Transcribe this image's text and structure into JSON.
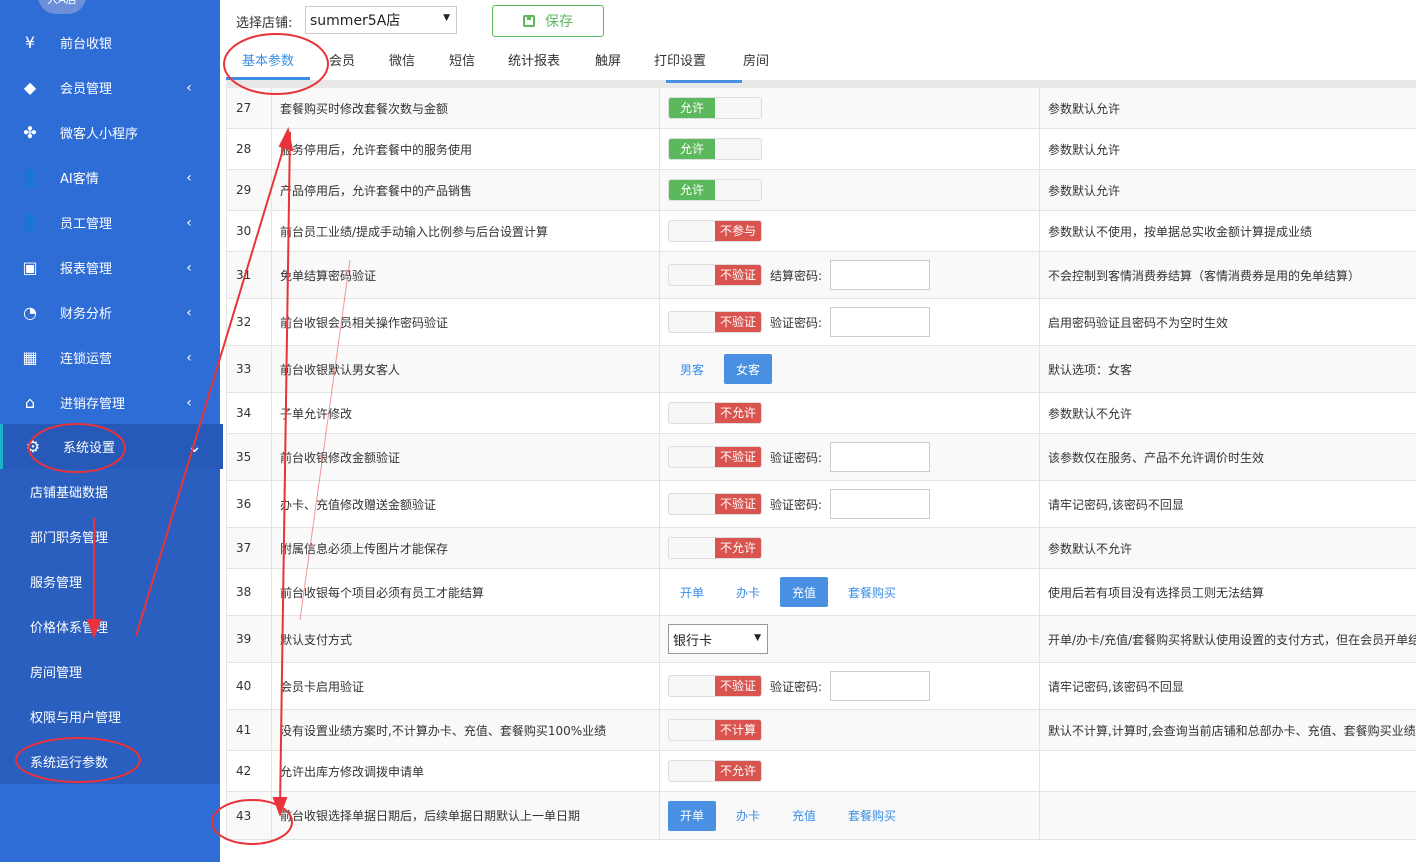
{
  "sidebar": {
    "logo_text": "人A店",
    "items": [
      {
        "label": "前台收银",
        "icon": "yen-icon",
        "chevron": false
      },
      {
        "label": "会员管理",
        "icon": "diamond-icon",
        "chevron": true
      },
      {
        "label": "微客人小程序",
        "icon": "clover-icon",
        "chevron": false
      },
      {
        "label": "AI客情",
        "icon": "user-search-icon",
        "chevron": true
      },
      {
        "label": "员工管理",
        "icon": "user-icon",
        "chevron": true
      },
      {
        "label": "报表管理",
        "icon": "monitor-icon",
        "chevron": true
      },
      {
        "label": "财务分析",
        "icon": "pie-chart-icon",
        "chevron": true
      },
      {
        "label": "连锁运营",
        "icon": "building-icon",
        "chevron": true
      },
      {
        "label": "进销存管理",
        "icon": "home-icon",
        "chevron": true
      },
      {
        "label": "系统设置",
        "icon": "gears-icon",
        "chevron": true,
        "active": true
      }
    ],
    "submenu": [
      "店铺基础数据",
      "部门职务管理",
      "服务管理",
      "价格体系管理",
      "房间管理",
      "权限与用户管理",
      "系统运行参数"
    ]
  },
  "topbar": {
    "store_label": "选择店铺:",
    "store_value": "summer5A店",
    "save_label": "保存"
  },
  "tabs": [
    "基本参数",
    "会员",
    "微信",
    "短信",
    "统计报表",
    "触屏",
    "打印设置",
    "房间"
  ],
  "active_tab": "基本参数",
  "rows": [
    {
      "no": "27",
      "name": "套餐购买时修改套餐次数与金额",
      "type": "toggle",
      "state": "on",
      "value": "允许",
      "note": "参数默认允许"
    },
    {
      "no": "28",
      "name": "服务停用后，允许套餐中的服务使用",
      "type": "toggle",
      "state": "on",
      "value": "允许",
      "note": "参数默认允许"
    },
    {
      "no": "29",
      "name": "产品停用后，允许套餐中的产品销售",
      "type": "toggle",
      "state": "on",
      "value": "允许",
      "note": "参数默认允许"
    },
    {
      "no": "30",
      "name": "前台员工业绩/提成手动输入比例参与后台设置计算",
      "type": "toggle",
      "state": "off",
      "value": "不参与",
      "note": "参数默认不使用，按单据总实收金额计算提成业绩"
    },
    {
      "no": "31",
      "name": "免单结算密码验证",
      "type": "toggle-pwd",
      "state": "off",
      "value": "不验证",
      "pwd_label": "结算密码:",
      "note": "不会控制到客情消费券结算（客情消费券是用的免单结算）"
    },
    {
      "no": "32",
      "name": "前台收银会员相关操作密码验证",
      "type": "toggle-pwd",
      "state": "off",
      "value": "不验证",
      "pwd_label": "验证密码:",
      "note": "启用密码验证且密码不为空时生效"
    },
    {
      "no": "33",
      "name": "前台收银默认男女客人",
      "type": "options",
      "options": [
        "男客",
        "女客"
      ],
      "selected": "女客",
      "note": "默认选项：女客"
    },
    {
      "no": "34",
      "name": "子单允许修改",
      "type": "toggle",
      "state": "off",
      "value": "不允许",
      "note": "参数默认不允许"
    },
    {
      "no": "35",
      "name": "前台收银修改金额验证",
      "type": "toggle-pwd",
      "state": "off",
      "value": "不验证",
      "pwd_label": "验证密码:",
      "note": "该参数仅在服务、产品不允许调价时生效"
    },
    {
      "no": "36",
      "name": "办卡、充值修改赠送金额验证",
      "type": "toggle-pwd",
      "state": "off",
      "value": "不验证",
      "pwd_label": "验证密码:",
      "note": "请牢记密码,该密码不回显"
    },
    {
      "no": "37",
      "name": "附属信息必须上传图片才能保存",
      "type": "toggle",
      "state": "off",
      "value": "不允许",
      "note": "参数默认不允许"
    },
    {
      "no": "38",
      "name": "前台收银每个项目必须有员工才能结算",
      "type": "options",
      "options": [
        "开单",
        "办卡",
        "充值",
        "套餐购买"
      ],
      "selected": "充值",
      "note": "使用后若有项目没有选择员工则无法结算"
    },
    {
      "no": "39",
      "name": "默认支付方式",
      "type": "select",
      "value": "银行卡",
      "note": "开单/办卡/充值/套餐购买将默认使用设置的支付方式，但在会员开单结"
    },
    {
      "no": "40",
      "name": "会员卡启用验证",
      "type": "toggle-pwd",
      "state": "off",
      "value": "不验证",
      "pwd_label": "验证密码:",
      "note": "请牢记密码,该密码不回显"
    },
    {
      "no": "41",
      "name": "没有设置业绩方案时,不计算办卡、充值、套餐购买100%业绩",
      "type": "toggle",
      "state": "off",
      "value": "不计算",
      "note": "默认不计算,计算时,会查询当前店铺和总部办卡、充值、套餐购买业绩方"
    },
    {
      "no": "42",
      "name": "允许出库方修改调拨申请单",
      "type": "toggle",
      "state": "off",
      "value": "不允许",
      "note": ""
    },
    {
      "no": "43",
      "name": "前台收银选择单据日期后，后续单据日期默认上一单日期",
      "type": "options",
      "options": [
        "开单",
        "办卡",
        "充值",
        "套餐购买"
      ],
      "selected": "开单",
      "note": ""
    }
  ],
  "colors": {
    "sidebar": "#2e6cd6",
    "accent": "#3a8ee6",
    "on": "#5cb85c",
    "off": "#d9534f",
    "annotation": "#e8333a"
  }
}
